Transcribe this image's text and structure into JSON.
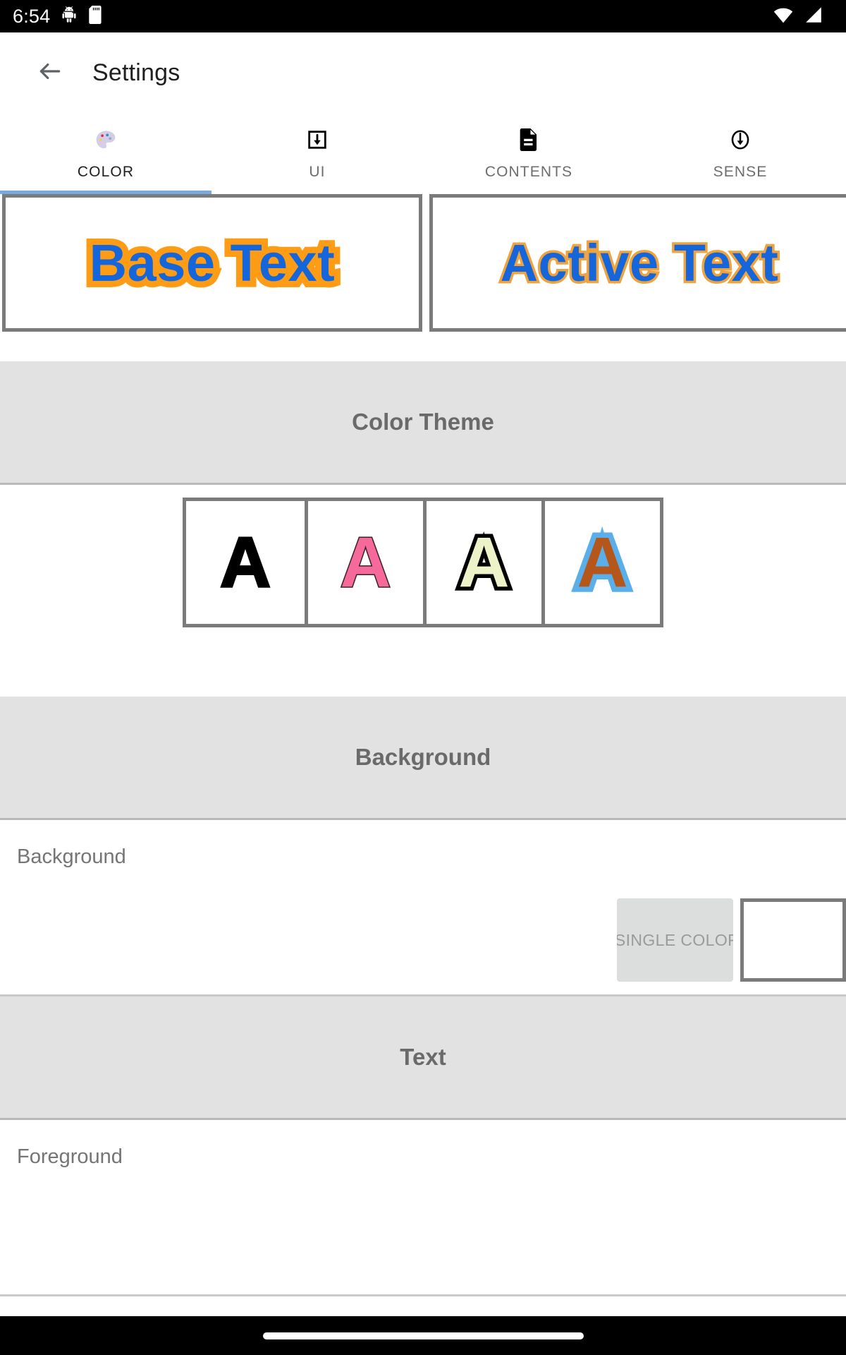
{
  "status_bar": {
    "time": "6:54",
    "icons": [
      "android-debug-icon",
      "sd-card-icon"
    ],
    "right_icons": [
      "wifi-icon",
      "cellular-signal-icon"
    ]
  },
  "app_bar": {
    "back_icon": "arrow-left-icon",
    "title": "Settings"
  },
  "tabs": {
    "active_index": 0,
    "indicator_color": "#7ca9dd",
    "items": [
      {
        "label": "COLOR",
        "icon": "palette-icon"
      },
      {
        "label": "UI",
        "icon": "download-box-icon"
      },
      {
        "label": "CONTENTS",
        "icon": "document-icon"
      },
      {
        "label": "SENSE",
        "icon": "circle-down-arrow-icon"
      }
    ]
  },
  "preview": {
    "base": {
      "text": "Base Text",
      "fill": "#1565db",
      "stroke": "#ff9c15"
    },
    "active": {
      "text": "Active Text",
      "fill": "#1565db",
      "stroke": "#f0a33d"
    }
  },
  "sections": {
    "color_theme": {
      "header": "Color Theme",
      "swatches": [
        {
          "glyph": "A",
          "fill": "#000000",
          "stroke": "#000000",
          "name": "theme-black"
        },
        {
          "glyph": "A",
          "fill": "#f56a9a",
          "stroke": "#3a2026",
          "name": "theme-pink"
        },
        {
          "glyph": "A",
          "fill": "#edf2c8",
          "stroke": "#000000",
          "name": "theme-pale-yellow"
        },
        {
          "glyph": "A",
          "fill": "#b5561a",
          "stroke": "#5aaeea",
          "name": "theme-brown-blue"
        }
      ]
    },
    "background": {
      "header": "Background",
      "row_title": "Background",
      "button_label": "SINGLE COLOR",
      "swatch_color": "#ffffff"
    },
    "text": {
      "header": "Text",
      "row_title": "Foreground"
    }
  }
}
